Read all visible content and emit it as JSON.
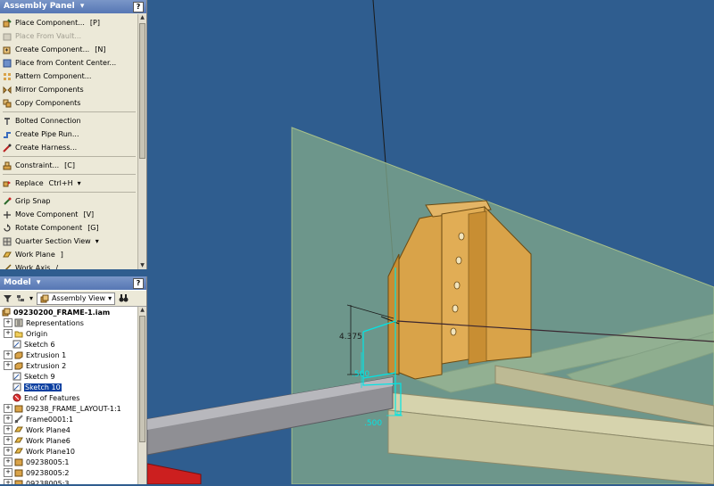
{
  "assembly_panel": {
    "title": "Assembly Panel",
    "help": "?",
    "items": [
      {
        "label": "Place Component...",
        "shortcut": "[P]",
        "icon": "place-component-icon"
      },
      {
        "label": "Place From Vault...",
        "shortcut": "",
        "icon": "vault-icon",
        "disabled": true
      },
      {
        "label": "Create Component...",
        "shortcut": "[N]",
        "icon": "create-component-icon"
      },
      {
        "label": "Place from Content Center...",
        "shortcut": "",
        "icon": "content-center-icon"
      },
      {
        "label": "Pattern Component...",
        "shortcut": "",
        "icon": "pattern-icon"
      },
      {
        "label": "Mirror Components",
        "shortcut": "",
        "icon": "mirror-icon"
      },
      {
        "label": "Copy Components",
        "shortcut": "",
        "icon": "copy-icon"
      },
      {
        "label": "Bolted Connection",
        "shortcut": "",
        "icon": "bolt-icon"
      },
      {
        "label": "Create Pipe Run...",
        "shortcut": "",
        "icon": "pipe-icon"
      },
      {
        "label": "Create Harness...",
        "shortcut": "",
        "icon": "harness-icon"
      },
      {
        "label": "Constraint...",
        "shortcut": "[C]",
        "icon": "constraint-icon"
      },
      {
        "label": "Replace",
        "shortcut": "Ctrl+H",
        "icon": "replace-icon"
      },
      {
        "label": "Grip Snap",
        "shortcut": "",
        "icon": "grip-snap-icon"
      },
      {
        "label": "Move Component",
        "shortcut": "[V]",
        "icon": "move-icon"
      },
      {
        "label": "Rotate Component",
        "shortcut": "[G]",
        "icon": "rotate-icon"
      },
      {
        "label": "Quarter Section View",
        "shortcut": "",
        "icon": "section-view-icon"
      },
      {
        "label": "Work Plane",
        "shortcut": "]",
        "icon": "work-plane-icon"
      },
      {
        "label": "Work Axis",
        "shortcut": "/",
        "icon": "work-axis-icon"
      }
    ]
  },
  "model_panel": {
    "title": "Model",
    "help": "?",
    "view": "Assembly View",
    "tree": [
      {
        "label": "09230200_FRAME-1.iam",
        "icon": "assembly-icon",
        "root": true
      },
      {
        "label": "Representations",
        "icon": "representations-icon",
        "expand": "+"
      },
      {
        "label": "Origin",
        "icon": "folder-icon",
        "expand": "+"
      },
      {
        "label": "Sketch 6",
        "icon": "sketch-icon"
      },
      {
        "label": "Extrusion 1",
        "icon": "extrusion-icon",
        "expand": "+"
      },
      {
        "label": "Extrusion 2",
        "icon": "extrusion-icon",
        "expand": "+"
      },
      {
        "label": "Sketch 9",
        "icon": "sketch-icon"
      },
      {
        "label": "Sketch 10",
        "icon": "sketch-icon",
        "selected": true
      },
      {
        "label": "End of Features",
        "icon": "end-of-features-icon"
      },
      {
        "label": "09238_FRAME_LAYOUT-1:1",
        "icon": "part-icon",
        "expand": "+"
      },
      {
        "label": "Frame0001:1",
        "icon": "frame-icon",
        "expand": "+"
      },
      {
        "label": "Work Plane4",
        "icon": "work-plane-icon",
        "expand": "+"
      },
      {
        "label": "Work Plane6",
        "icon": "work-plane-icon",
        "expand": "+"
      },
      {
        "label": "Work Plane10",
        "icon": "work-plane-icon",
        "expand": "+"
      },
      {
        "label": "09238005:1",
        "icon": "part-icon",
        "expand": "+"
      },
      {
        "label": "09238005:2",
        "icon": "part-icon",
        "expand": "+"
      },
      {
        "label": "09238005:3",
        "icon": "part-icon",
        "expand": "+"
      }
    ]
  },
  "viewport": {
    "dimensions": [
      "4.375",
      ".500",
      ".500"
    ],
    "colors": {
      "background": "#2f5d8f",
      "work_plane": "#7fa68a",
      "bracket": "#d9a349",
      "frame_rail": "#d6d3ad",
      "sketch": "#00e5e5"
    }
  }
}
